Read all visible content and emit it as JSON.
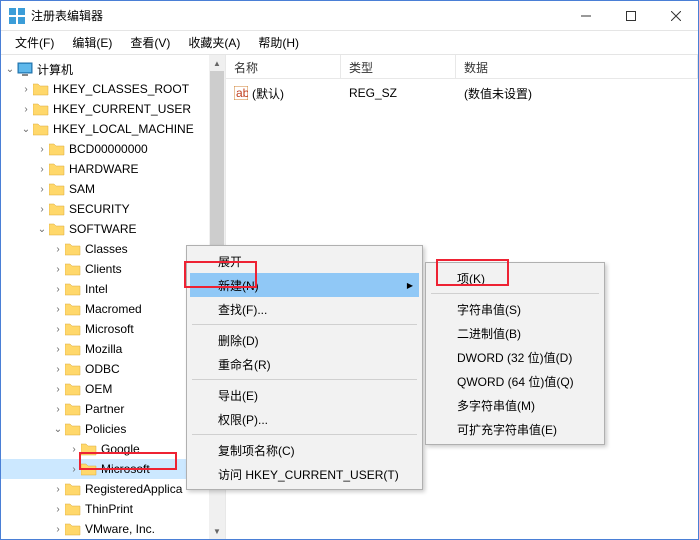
{
  "window": {
    "title": "注册表编辑器"
  },
  "menu": {
    "file": "文件(F)",
    "edit": "编辑(E)",
    "view": "查看(V)",
    "fav": "收藏夹(A)",
    "help": "帮助(H)"
  },
  "list_headers": {
    "name": "名称",
    "type": "类型",
    "data": "数据"
  },
  "default_value": {
    "name": "(默认)",
    "type": "REG_SZ",
    "data": "(数值未设置)"
  },
  "tree": {
    "root": "计算机",
    "hklm": "HKEY_LOCAL_MACHINE",
    "hkcr": "HKEY_CLASSES_ROOT",
    "hkcu": "HKEY_CURRENT_USER",
    "bcd": "BCD00000000",
    "hardware": "HARDWARE",
    "sam": "SAM",
    "security": "SECURITY",
    "software": "SOFTWARE",
    "classes": "Classes",
    "clients": "Clients",
    "intel": "Intel",
    "macromed": "Macromed",
    "microsoft": "Microsoft",
    "mozilla": "Mozilla",
    "odbc": "ODBC",
    "oem": "OEM",
    "partner": "Partner",
    "policies": "Policies",
    "google": "Google",
    "ms_sel": "Microsoft",
    "regapp": "RegisteredApplica",
    "thinprint": "ThinPrint",
    "vmware": "VMware, Inc."
  },
  "ctx1": {
    "expand": "展开",
    "new": "新建(N)",
    "find": "查找(F)...",
    "delete": "删除(D)",
    "rename": "重命名(R)",
    "export": "导出(E)",
    "perm": "权限(P)...",
    "copykey": "复制项名称(C)",
    "goto": "访问 HKEY_CURRENT_USER(T)"
  },
  "ctx2": {
    "key": "项(K)",
    "string": "字符串值(S)",
    "binary": "二进制值(B)",
    "dword": "DWORD (32 位)值(D)",
    "qword": "QWORD (64 位)值(Q)",
    "multi": "多字符串值(M)",
    "expand": "可扩充字符串值(E)"
  }
}
